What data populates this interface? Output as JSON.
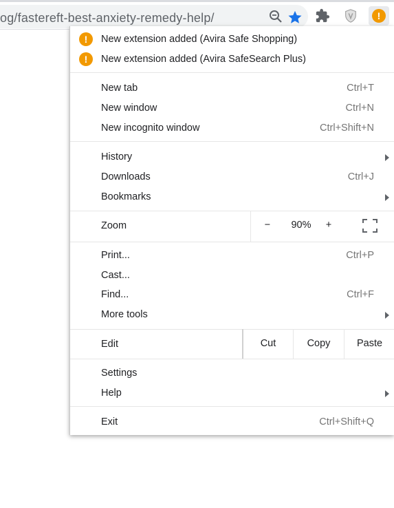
{
  "address_bar": {
    "url": "og/fastereft-best-anxiety-remedy-help/"
  },
  "toolbar_icons": [
    "zoom-out-icon",
    "bookmark-star-icon",
    "puzzle-extension-icon",
    "avira-shield-icon",
    "alert-menu-icon"
  ],
  "colors": {
    "accent": "#1a73e8",
    "warning": "#f29900",
    "star": "#1a73e8"
  },
  "menu": {
    "notifications": [
      {
        "icon": "!",
        "label": "New extension added (Avira Safe Shopping)"
      },
      {
        "icon": "!",
        "label": "New extension added (Avira SafeSearch Plus)"
      }
    ],
    "new_tab": {
      "label": "New tab",
      "shortcut": "Ctrl+T"
    },
    "new_window": {
      "label": "New window",
      "shortcut": "Ctrl+N"
    },
    "new_incognito": {
      "label": "New incognito window",
      "shortcut": "Ctrl+Shift+N"
    },
    "history": {
      "label": "History"
    },
    "downloads": {
      "label": "Downloads",
      "shortcut": "Ctrl+J"
    },
    "bookmarks": {
      "label": "Bookmarks"
    },
    "zoom": {
      "label": "Zoom",
      "minus": "−",
      "value": "90%",
      "plus": "+"
    },
    "print": {
      "label": "Print...",
      "shortcut": "Ctrl+P"
    },
    "cast": {
      "label": "Cast..."
    },
    "find": {
      "label": "Find...",
      "shortcut": "Ctrl+F"
    },
    "more_tools": {
      "label": "More tools"
    },
    "edit": {
      "label": "Edit",
      "cut": "Cut",
      "copy": "Copy",
      "paste": "Paste"
    },
    "settings": {
      "label": "Settings"
    },
    "help": {
      "label": "Help"
    },
    "exit": {
      "label": "Exit",
      "shortcut": "Ctrl+Shift+Q"
    }
  }
}
